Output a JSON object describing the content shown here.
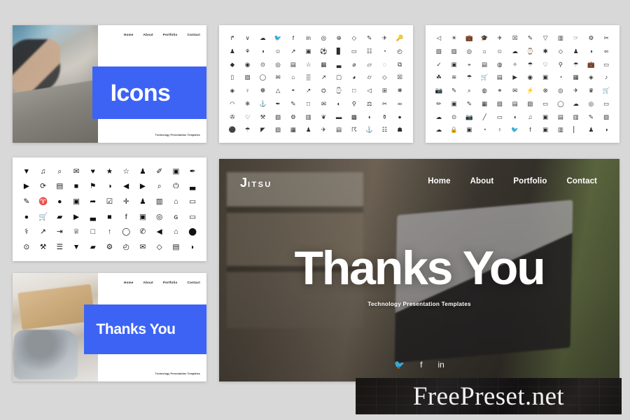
{
  "page": {
    "background_color": "#d8d8d8",
    "accent_color": "#3d63f5"
  },
  "slides": {
    "cover": {
      "title": "Icons",
      "nav": [
        "Home",
        "About",
        "Portfolio",
        "Contact"
      ],
      "tagline": "Technology Presentation Templates"
    },
    "thanks_small": {
      "title": "Thanks You",
      "nav": [
        "Home",
        "About",
        "Portfolio",
        "Contact"
      ],
      "tagline": "Technology Presentation Templates"
    },
    "thanks_big": {
      "logo_first": "J",
      "logo_rest": "ITSU",
      "nav": [
        "Home",
        "About",
        "Portfolio",
        "Contact"
      ],
      "title": "Thanks You",
      "tagline": "Technology Presentation Templates",
      "social": [
        "twitter-icon",
        "facebook-icon",
        "linkedin-icon"
      ],
      "social_glyphs": [
        "🐦",
        "f",
        "in"
      ]
    },
    "icon_sheet_outline_a": {
      "columns": 12,
      "rows": 8,
      "glyphs": [
        "↱",
        "∨",
        "☁",
        "🐦",
        "f",
        "in",
        "◎",
        "⊕",
        "◇",
        "✎",
        "✈",
        "🔑",
        "♟",
        "⚘",
        "◑",
        "☺",
        "↗",
        "▣",
        "⚽",
        "▊",
        "▭",
        "☷",
        "◔",
        "◴",
        "◆",
        "◉",
        "⊙",
        "◎",
        "▤",
        "☆",
        "▦",
        "▃",
        "⌀",
        "▱",
        "◌",
        "⧉",
        "▯",
        "▨",
        "◯",
        "✉",
        "⌂",
        "▒",
        "↗",
        "▢",
        "◕",
        "⌭",
        "◇",
        "☒",
        "◈",
        "♀",
        "☸",
        "△",
        "◓",
        "↗",
        "⛭",
        "⌚",
        "□",
        "◁",
        "⊞",
        "❅",
        "◠",
        "❄",
        "⚓",
        "✒",
        "✎",
        "□",
        "✉",
        "◐",
        "⚲",
        "⚖",
        "✂",
        "∞",
        "✇",
        "♡",
        "⚒",
        "▧",
        "⚙",
        "▥",
        "❦",
        "▬",
        "▩",
        "◖",
        "⚱",
        "●",
        "⚫",
        "☂",
        "◤",
        "▧",
        "▦",
        "♟",
        "✈",
        "▤",
        "☈",
        "⚓",
        "☷",
        "☗"
      ]
    },
    "icon_sheet_outline_b": {
      "columns": 12,
      "rows": 8,
      "glyphs": [
        "◁",
        "☀",
        "💼",
        "🎓",
        "✈",
        "☒",
        "✎",
        "▽",
        "▥",
        "☞",
        "⚙",
        "✂",
        "▧",
        "▨",
        "◎",
        "☼",
        "☺",
        "☁",
        "⌚",
        "✱",
        "◇",
        "♟",
        "◑",
        "∞",
        "✓",
        "▣",
        "⌖",
        "▤",
        "◍",
        "✧",
        "☂",
        "♡",
        "⚲",
        "☂",
        "💼",
        "▭",
        "☘",
        "≋",
        "☂",
        "🛒",
        "▤",
        "▶",
        "◉",
        "▣",
        "◔",
        "▦",
        "◈",
        "♪",
        "📷",
        "✎",
        "⌕",
        "◍",
        "⚭",
        "✉",
        "⚡",
        "⊗",
        "◎",
        "✈",
        "♛",
        "🛒",
        "✏",
        "▣",
        "✎",
        "▦",
        "▧",
        "▤",
        "▨",
        "▭",
        "◯",
        "☁",
        "◎",
        "▭",
        "☁",
        "⊙",
        "📷",
        "╱",
        "▭",
        "◖",
        "♫",
        "▣",
        "▤",
        "▥",
        "✎",
        "▨",
        "☁",
        "🔒",
        "▣",
        "◔",
        "♀",
        "🐦",
        "f",
        "▣",
        "▥",
        "▏",
        "♟",
        "◑"
      ]
    },
    "icon_sheet_solid": {
      "columns": 11,
      "rows": 6,
      "glyphs": [
        "▼",
        "♫",
        "⌕",
        "✉",
        "♥",
        "★",
        "☆",
        "♟",
        "✐",
        "▣",
        "✒",
        "▶",
        "⟳",
        "▤",
        "■",
        "⚑",
        "◑",
        "◀",
        "▶",
        "⌕",
        "⏻",
        "▃",
        "✎",
        "♈",
        "●",
        "▣",
        "➦",
        "☑",
        "✛",
        "♟",
        "▥",
        "⌂",
        "▭",
        "●",
        "🛒",
        "▰",
        "▶",
        "▃",
        "■",
        "f",
        "▣",
        "◎",
        "ɢ",
        "▭",
        "⚕",
        "↗",
        "⇥",
        "♕",
        "□",
        "↑",
        "◯",
        "✆",
        "◀",
        "⌂",
        "⬤",
        "⊙",
        "⚒",
        "☰",
        "▼",
        "▰",
        "⚙",
        "◴",
        "✉",
        "◇",
        "▤",
        "◗"
      ]
    }
  },
  "watermark": {
    "text": "FreePreset.net"
  }
}
